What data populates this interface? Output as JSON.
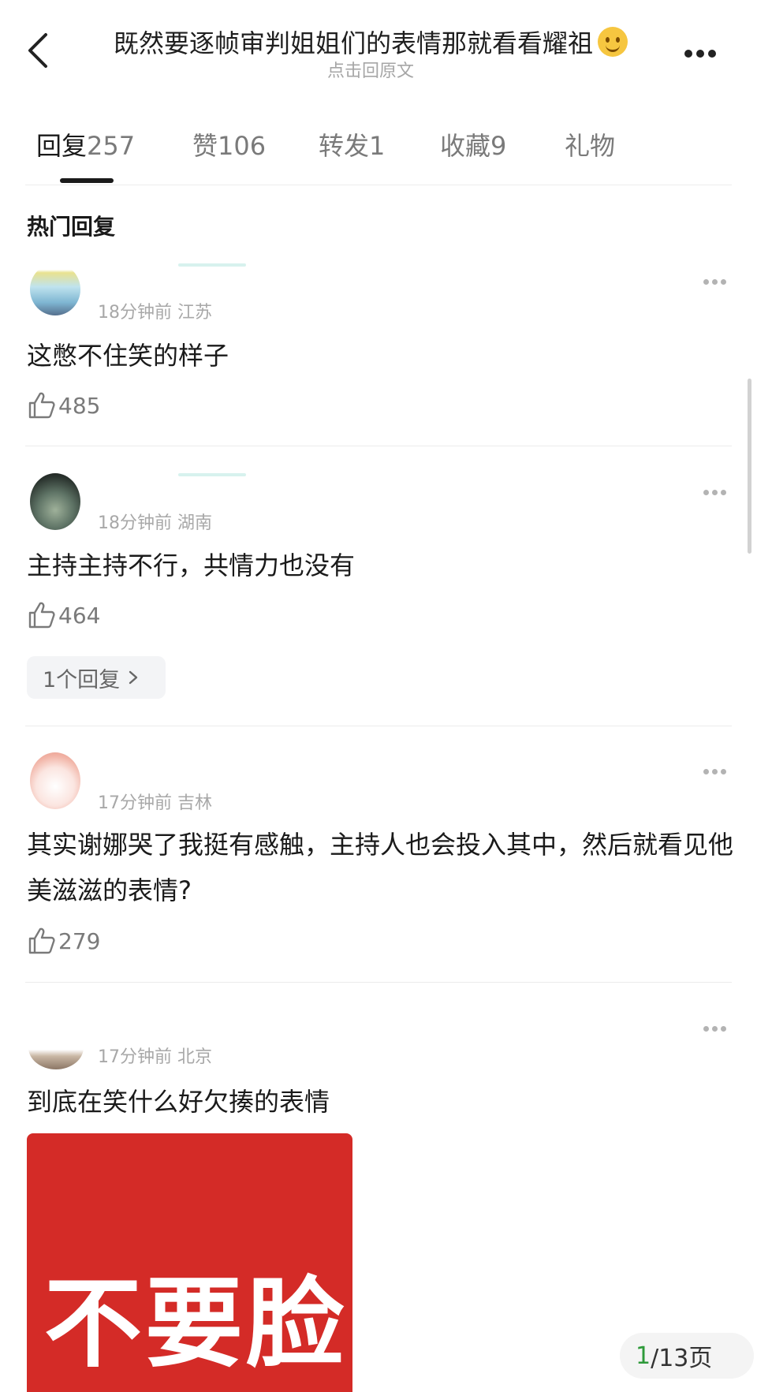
{
  "header": {
    "title": "既然要逐帧审判姐姐们的表情那就看看耀祖",
    "title_emoji": "slightly-smiling-face",
    "subtitle": "点击回原文"
  },
  "tabs": [
    {
      "label": "回复",
      "count": "257",
      "active": true
    },
    {
      "label": "赞",
      "count": "106",
      "active": false
    },
    {
      "label": "转发",
      "count": "1",
      "active": false
    },
    {
      "label": "收藏",
      "count": "9",
      "active": false
    },
    {
      "label": "礼物",
      "count": "",
      "active": false
    }
  ],
  "section_title": "热门回复",
  "comments": [
    {
      "meta": "18分钟前 江苏",
      "text": "这憋不住笑的样子",
      "likes": "485"
    },
    {
      "meta": "18分钟前 湖南",
      "text": "主持主持不行，共情力也没有",
      "likes": "464",
      "replies_label": "1个回复"
    },
    {
      "meta": "17分钟前 吉林",
      "text": "其实谢娜哭了我挺有感触，主持人也会投入其中，然后就看见他美滋滋的表情?",
      "likes": "279"
    },
    {
      "meta": "17分钟前 北京",
      "text": "到底在笑什么好欠揍的表情",
      "sticker_text": "不要脸"
    }
  ],
  "pagination": {
    "current": "1",
    "rest": "/13页"
  },
  "colors": {
    "accent": "#1a1a1a",
    "sticker_bg": "#d42b27",
    "page_current": "#2e9a3a"
  }
}
